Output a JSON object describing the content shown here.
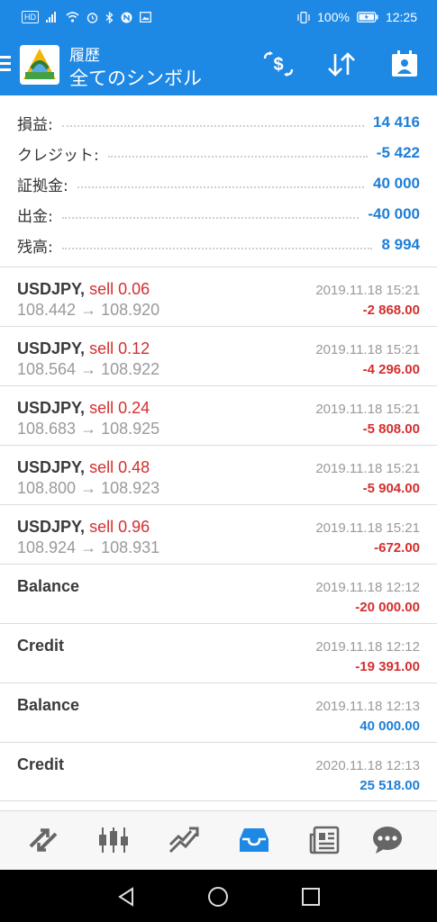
{
  "status_bar": {
    "time": "12:25",
    "battery": "100%",
    "hd_badge": "HD"
  },
  "toolbar": {
    "subtitle": "履歴",
    "title": "全てのシンボル"
  },
  "summary": [
    {
      "label": "損益:",
      "value": "14 416"
    },
    {
      "label": "クレジット:",
      "value": "-5 422"
    },
    {
      "label": "証拠金:",
      "value": "40 000"
    },
    {
      "label": "出金:",
      "value": "-40 000"
    },
    {
      "label": "残高:",
      "value": "8 994"
    }
  ],
  "deals": [
    {
      "symbol": "USDJPY,",
      "type": "sell 0.06",
      "prices": "108.442 → 108.920",
      "time": "2019.11.18 15:21",
      "profit": "-2 868.00",
      "sign": "neg"
    },
    {
      "symbol": "USDJPY,",
      "type": "sell 0.12",
      "prices": "108.564 → 108.922",
      "time": "2019.11.18 15:21",
      "profit": "-4 296.00",
      "sign": "neg"
    },
    {
      "symbol": "USDJPY,",
      "type": "sell 0.24",
      "prices": "108.683 → 108.925",
      "time": "2019.11.18 15:21",
      "profit": "-5 808.00",
      "sign": "neg"
    },
    {
      "symbol": "USDJPY,",
      "type": "sell 0.48",
      "prices": "108.800 → 108.923",
      "time": "2019.11.18 15:21",
      "profit": "-5 904.00",
      "sign": "neg"
    },
    {
      "symbol": "USDJPY,",
      "type": "sell 0.96",
      "prices": "108.924 → 108.931",
      "time": "2019.11.18 15:21",
      "profit": "-672.00",
      "sign": "neg"
    },
    {
      "symbol": "Balance",
      "type": "",
      "prices": "",
      "time": "2019.11.18 12:12",
      "profit": "-20 000.00",
      "sign": "neg"
    },
    {
      "symbol": "Credit",
      "type": "",
      "prices": "",
      "time": "2019.11.18 12:12",
      "profit": "-19 391.00",
      "sign": "neg"
    },
    {
      "symbol": "Balance",
      "type": "",
      "prices": "",
      "time": "2019.11.18 12:13",
      "profit": "40 000.00",
      "sign": "pos"
    },
    {
      "symbol": "Credit",
      "type": "",
      "prices": "",
      "time": "2020.11.18 12:13",
      "profit": "25 518.00",
      "sign": "pos"
    }
  ],
  "bottom_nav": [
    {
      "icon": "quotes-icon"
    },
    {
      "icon": "chart-icon"
    },
    {
      "icon": "trade-icon"
    },
    {
      "icon": "history-icon",
      "active": true
    },
    {
      "icon": "news-icon"
    },
    {
      "icon": "chat-icon"
    }
  ],
  "colors": {
    "accent": "#1e88e5",
    "positive": "#1e7fd6",
    "negative": "#d32f2f"
  }
}
